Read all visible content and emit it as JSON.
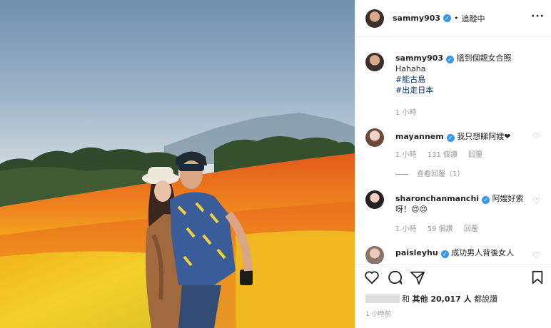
{
  "post": {
    "username": "sammy903",
    "follow_status": "追蹤中",
    "more": "···",
    "icons": {
      "verified": "verified-badge-icon",
      "more": "more-options-icon",
      "like": "heart-outline-icon",
      "comment": "comment-bubble-icon",
      "share": "share-plane-icon",
      "save": "bookmark-icon"
    },
    "colors": {
      "verified": "#3897f0",
      "hashtag": "#003569",
      "muted": "#999999"
    }
  },
  "caption": {
    "username": "sammy903",
    "text": "搵到個靚女合照",
    "line2": "Hahaha",
    "tag1": "#能古島",
    "tag2": "#出走日本",
    "time": "1 小時"
  },
  "comments": [
    {
      "username": "mayannem",
      "text": "我只想睇阿嫂❤",
      "time": "1 小時",
      "likes": "131 個讚",
      "reply": "回覆"
    },
    {
      "username": "sharonchanmanchi",
      "text": "阿嫂好索",
      "text2": "呀！😍😍",
      "time": "1 小時",
      "likes": "59 個讚",
      "reply": "回覆"
    },
    {
      "username": "paisleyhu",
      "text": "成功男人背後女人"
    }
  ],
  "view_replies": "查看回覆（1）",
  "likes_line": {
    "prefix": "和 ",
    "others": "其他 20,017 人",
    "suffix": " 都說讚"
  },
  "post_time": "1 小時前"
}
